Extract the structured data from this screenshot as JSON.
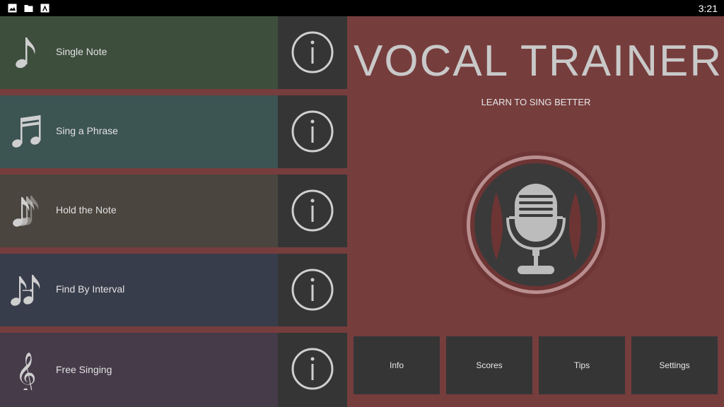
{
  "status_bar": {
    "time": "3:21",
    "icons": [
      "image-icon",
      "folder-icon",
      "android-icon"
    ]
  },
  "modes": [
    {
      "label": "Single Note",
      "icon": "eighth-note-icon",
      "color": "#3d4e3d"
    },
    {
      "label": "Sing a Phrase",
      "icon": "beamed-notes-icon",
      "color": "#3c5452"
    },
    {
      "label": "Hold the Note",
      "icon": "repeated-notes-icon",
      "color": "#4a453e"
    },
    {
      "label": "Find By Interval",
      "icon": "interval-notes-icon",
      "color": "#383d4b"
    },
    {
      "label": "Free Singing",
      "icon": "treble-clef-icon",
      "color": "#453b49"
    }
  ],
  "header": {
    "title": "VOCAL TRAINER",
    "subtitle": "LEARN TO SING BETTER"
  },
  "nav": {
    "info_label": "Info",
    "scores_label": "Scores",
    "tips_label": "Tips",
    "settings_label": "Settings"
  },
  "colors": {
    "accent_bg": "#763d3d",
    "dark_tile": "#353535",
    "mic_ring": "#6d3434"
  }
}
